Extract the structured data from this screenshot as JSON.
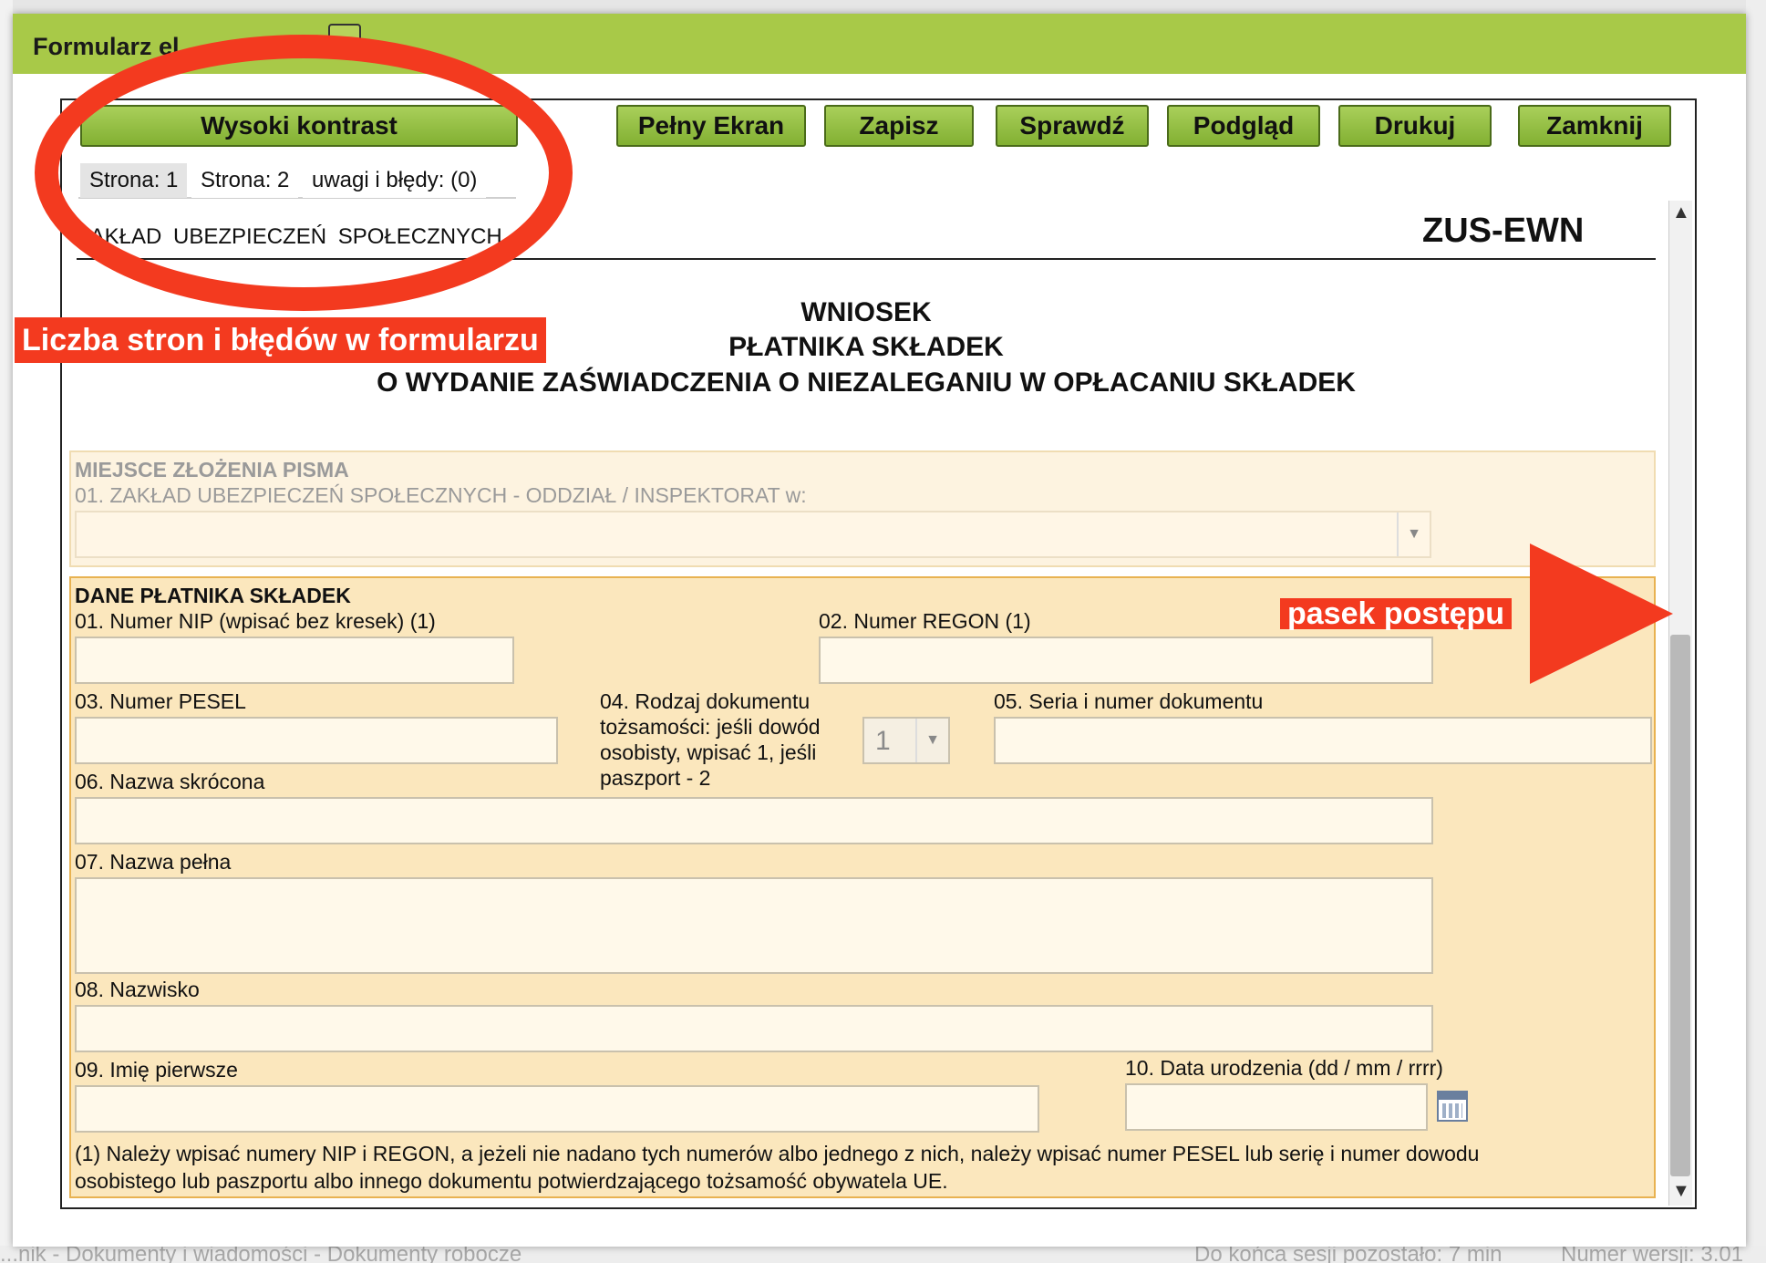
{
  "window": {
    "title": "Formularz el..."
  },
  "toolbar": {
    "high_contrast": "Wysoki kontrast",
    "fullscreen": "Pełny Ekran",
    "save": "Zapisz",
    "check": "Sprawdź",
    "preview": "Podgląd",
    "print": "Drukuj",
    "close": "Zamknij"
  },
  "tabs": [
    {
      "label": "Strona: 1",
      "active": true
    },
    {
      "label": "Strona: 2",
      "active": false
    },
    {
      "label": "uwagi i błędy: (0)",
      "active": false
    }
  ],
  "form": {
    "institution": "ZAKŁAD UBEZPIECZEŃ SPOŁECZNYCH",
    "code": "ZUS-EWN",
    "heading_line1": "WNIOSEK",
    "heading_line2": "PŁATNIKA SKŁADEK",
    "heading_line3": "O WYDANIE ZAŚWIADCZENIA O NIEZALEGANIU W OPŁACANIU SKŁADEK",
    "place": {
      "section_title": "MIEJSCE ZŁOŻENIA PISMA",
      "field_01_label": "01. ZAKŁAD UBEZPIECZEŃ SPOŁECZNYCH - ODDZIAŁ / INSPEKTORAT w:",
      "field_01_value": ""
    },
    "payer": {
      "section_title": "DANE PŁATNIKA SKŁADEK",
      "nip_label": "01. Numer NIP (wpisać bez kresek) (1)",
      "regon_label": "02. Numer REGON (1)",
      "pesel_label": "03. Numer PESEL",
      "doc_type_label_1": "04. Rodzaj dokumentu",
      "doc_type_label_2": "tożsamości: jeśli dowód",
      "doc_type_label_3": "osobisty, wpisać 1, jeśli",
      "doc_type_label_4": "paszport - 2",
      "doc_type_value": "1",
      "doc_number_label": "05. Seria i numer dokumentu",
      "short_name_label": "06. Nazwa skrócona",
      "full_name_label": "07. Nazwa pełna",
      "surname_label": "08. Nazwisko",
      "first_name_label": "09. Imię pierwsze",
      "birth_date_label": "10. Data urodzenia (dd / mm / rrrr)",
      "footnote_line1": "(1) Należy wpisać numery NIP i REGON, a jeżeli nie nadano tych numerów albo jednego z nich, należy wpisać numer PESEL lub serię i numer dowodu",
      "footnote_line2": "osobistego lub paszportu albo innego dokumentu potwierdzającego tożsamość obywatela UE."
    }
  },
  "annotations": {
    "errors_label": "Liczba stron i błędów w formularzu",
    "progress_label": "pasek postępu"
  },
  "status_bar": {
    "breadcrumb": "...nik - Dokumenty i wiadomości - Dokumenty robocze",
    "session": "Do końca sesji pozostało: 7 min",
    "version": "Numer wersji: 3.01"
  },
  "colors": {
    "titlebar": "#a8c948",
    "button": "#94c043",
    "section_bg": "#fbe7bd",
    "annotation": "#f33a1f"
  }
}
